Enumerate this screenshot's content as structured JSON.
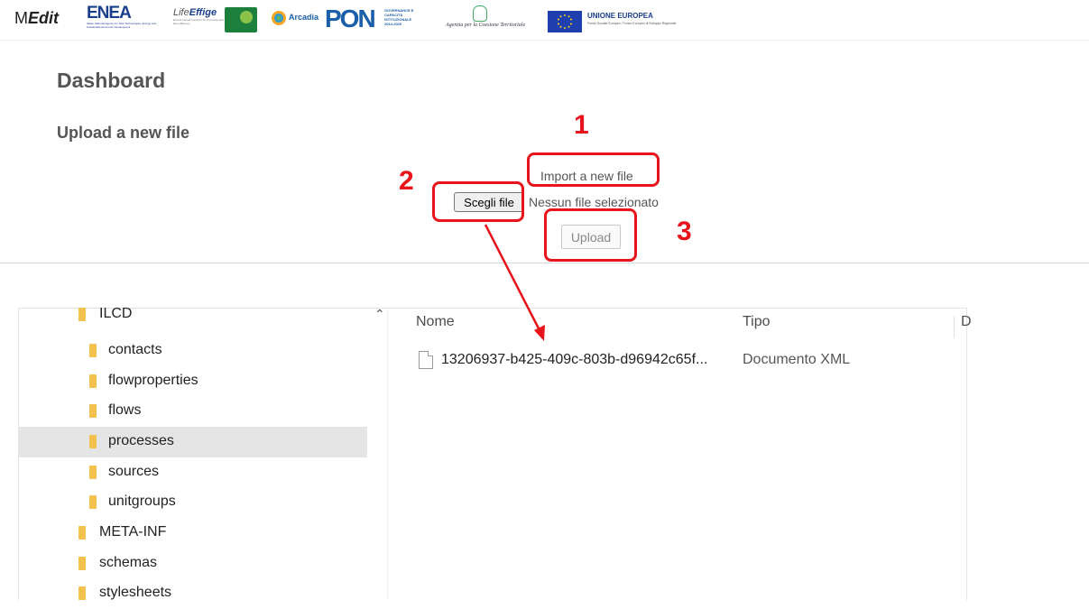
{
  "header": {
    "medit_prefix": "M",
    "medit_bold": "Edit",
    "enea": "ENEA",
    "enea_small": "Italian National Agency for New Technologies, Energy and Sustainable Economic Development",
    "effige_prefix": "Life",
    "effige_bold": "Effige",
    "effige_small": "Environmental Footprint for improving and Fostering Eco-efficiency",
    "arcadia": "Arcadia",
    "pon": "PON",
    "pon_side": "GOVERNANCE E CAPACITÀ ISTITUZIONALE 2014-2020",
    "agenzia": "Agenzia per la Coesione Territoriale",
    "ue_title": "UNIONE EUROPEA",
    "ue_sub": "Fondo Sociale Europeo / Fondo Europeo di Sviluppo Regionale"
  },
  "dashboard": {
    "title": "Dashboard",
    "section_title": "Upload a new file",
    "import_label": "Import a new file",
    "choose_file_button": "Scegli file",
    "file_status": "Nessun file selezionato",
    "upload_button": "Upload"
  },
  "annotations": {
    "step1": "1",
    "step2": "2",
    "step3": "3",
    "color": "#e8141c"
  },
  "explorer": {
    "tree": [
      {
        "label": "ILCD"
      },
      {
        "label": "contacts"
      },
      {
        "label": "flowproperties"
      },
      {
        "label": "flows"
      },
      {
        "label": "processes"
      },
      {
        "label": "sources"
      },
      {
        "label": "unitgroups"
      },
      {
        "label": "META-INF"
      },
      {
        "label": "schemas"
      },
      {
        "label": "stylesheets"
      }
    ],
    "selected_item": "processes",
    "columns": {
      "name": "Nome",
      "type": "Tipo",
      "extra": "D"
    },
    "files": [
      {
        "name": "13206937-b425-409c-803b-d96942c65f...",
        "type": "Documento XML"
      }
    ],
    "folder_color": "#f2c14e"
  }
}
